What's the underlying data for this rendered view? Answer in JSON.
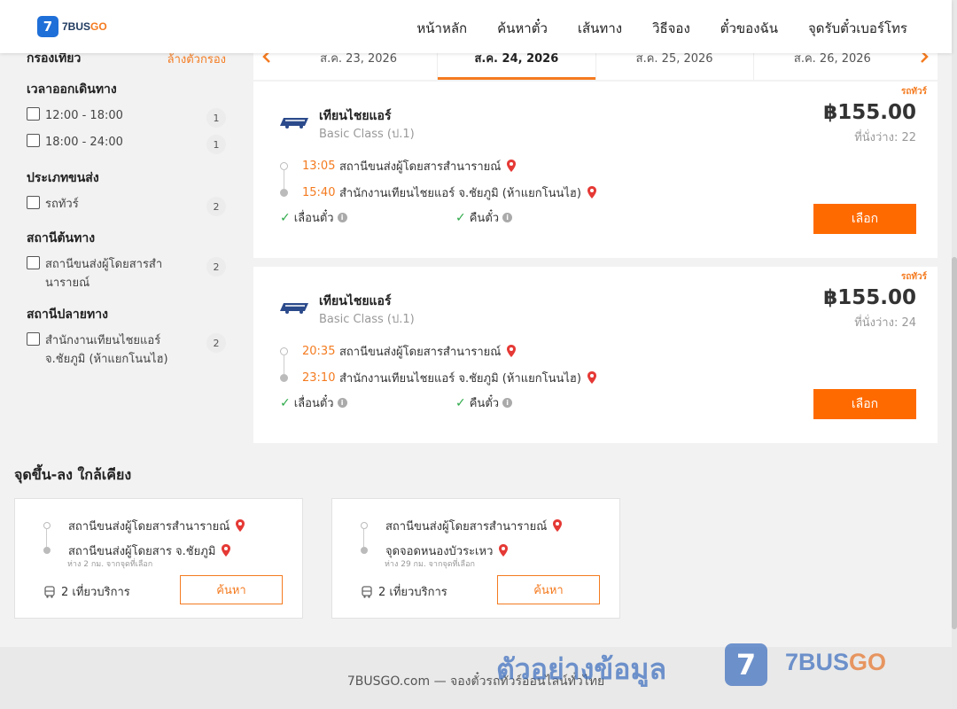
{
  "header": {
    "logo_mark": "7",
    "logo_text_a": "7BUS",
    "logo_text_b": "GO",
    "nav": [
      "หน้าหลัก",
      "ค้นหาตั๋ว",
      "เส้นทาง",
      "วิธีจอง",
      "ตั๋วของฉัน",
      "จุดรับตั๋วเบอร์โทร"
    ]
  },
  "sidebar": {
    "title": "กรองเที่ยว",
    "clear": "ล้างตัวกรอง",
    "groups": [
      {
        "title": "เวลาออกเดินทาง",
        "options": [
          {
            "label": "12:00 - 18:00",
            "count": "1"
          },
          {
            "label": "18:00 - 24:00",
            "count": "1"
          }
        ]
      },
      {
        "title": "ประเภทขนส่ง",
        "options": [
          {
            "label": "รถทัวร์",
            "count": "2"
          }
        ]
      },
      {
        "title": "สถานีต้นทาง",
        "options": [
          {
            "label": "สถานีขนส่งผู้โดยสารสำนารายณ์",
            "count": "2"
          }
        ]
      },
      {
        "title": "สถานีปลายทาง",
        "options": [
          {
            "label": "สำนักงานเทียนไชยแอร์ จ.ชัยภูมิ (ห้าแยกโนนไฮ)",
            "count": "2"
          }
        ]
      }
    ]
  },
  "dates": {
    "prev": "‹",
    "next": "›",
    "tabs": [
      "ส.ค. 23, 2026",
      "ส.ค. 24, 2026",
      "ส.ค. 25, 2026",
      "ส.ค. 26, 2026"
    ],
    "active_index": 1
  },
  "trips": [
    {
      "type_tag": "รถทัวร์",
      "operator": "เทียนไชยแอร์",
      "class": "Basic Class (ป.1)",
      "price": "฿155.00",
      "seats": "ที่นั่งว่าง: 22",
      "depart_time": "13:05",
      "depart_station": "สถานีขนส่งผู้โดยสารสำนารายณ์",
      "arrive_time": "15:40",
      "arrive_station": "สำนักงานเทียนไชยแอร์ จ.ชัยภูมิ (ห้าแยกโนนไฮ)",
      "feature_1": "เลื่อนตั๋ว",
      "feature_2": "คืนตั๋ว",
      "button": "เลือก"
    },
    {
      "type_tag": "รถทัวร์",
      "operator": "เทียนไชยแอร์",
      "class": "Basic Class (ป.1)",
      "price": "฿155.00",
      "seats": "ที่นั่งว่าง: 24",
      "depart_time": "20:35",
      "depart_station": "สถานีขนส่งผู้โดยสารสำนารายณ์",
      "arrive_time": "23:10",
      "arrive_station": "สำนักงานเทียนไชยแอร์ จ.ชัยภูมิ (ห้าแยกโนนไฮ)",
      "feature_1": "เลื่อนตั๋ว",
      "feature_2": "คืนตั๋ว",
      "button": "เลือก"
    }
  ],
  "nearby": {
    "title": "จุดขึ้น-ลง ใกล้เคียง",
    "cards": [
      {
        "from": "สถานีขนส่งผู้โดยสารสำนารายณ์",
        "to": "สถานีขนส่งผู้โดยสาร จ.ชัยภูมิ",
        "distance": "ห่าง 2 กม. จากจุดที่เลือก",
        "trips": "2 เที่ยวบริการ",
        "button": "ค้นหา"
      },
      {
        "from": "สถานีขนส่งผู้โดยสารสำนารายณ์",
        "to": "จุดจอดหนองบัวระเหว",
        "distance": "ห่าง 29 กม. จากจุดที่เลือก",
        "trips": "2 เที่ยวบริการ",
        "button": "ค้นหา"
      }
    ]
  },
  "footer": {
    "text": "7BUSGO.com — จองตั๋วรถทัวร์ออนไลน์ทั่วไทย"
  },
  "watermark": {
    "text": "ตัวอย่างข้อมูล",
    "logo_mark": "7",
    "brand_a": "7BUS",
    "brand_b": "GO"
  },
  "colors": {
    "accent": "#f47b20",
    "button": "#ff6a00",
    "check": "#2eaa4a",
    "pin": "#e53935",
    "brand_blue": "#1f6fd8"
  }
}
